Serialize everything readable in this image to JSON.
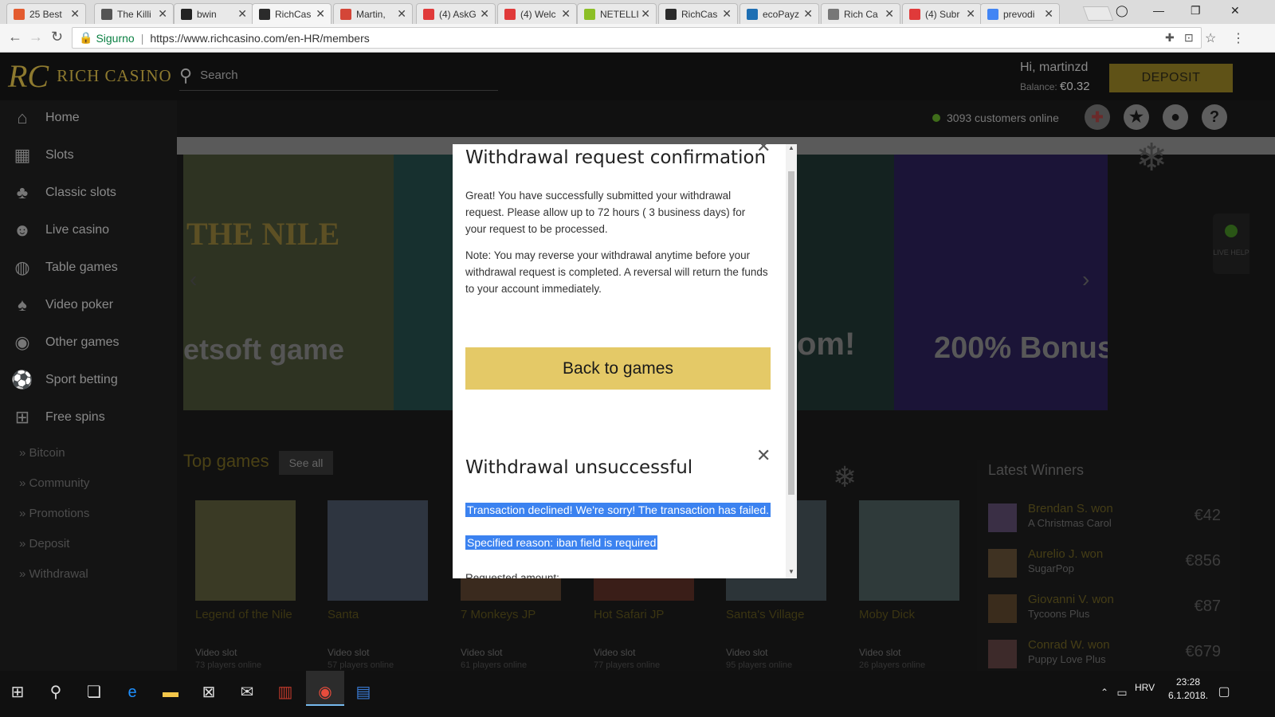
{
  "browser": {
    "tabs": [
      {
        "title": "25 Best",
        "color": "#e35b2f"
      },
      {
        "title": "The Killi",
        "color": "#555"
      },
      {
        "title": "bwin",
        "color": "#222"
      },
      {
        "title": "RichCas",
        "color": "#2b2b2b"
      },
      {
        "title": "Martin,",
        "color": "#d44638"
      },
      {
        "title": "(4) AskG",
        "color": "#e03a3a"
      },
      {
        "title": "(4) Welc",
        "color": "#e03a3a"
      },
      {
        "title": "NETELLI",
        "color": "#8cbf26"
      },
      {
        "title": "RichCas",
        "color": "#2b2b2b"
      },
      {
        "title": "ecoPayz",
        "color": "#1e6fb3"
      },
      {
        "title": "Rich Ca",
        "color": "#777"
      },
      {
        "title": "(4) Subr",
        "color": "#e03a3a"
      },
      {
        "title": "prevodi",
        "color": "#4285f4"
      }
    ],
    "secure_label": "Sigurno",
    "url": "https://www.richcasino.com/en-HR/members"
  },
  "site": {
    "brand": "RICH CASINO",
    "brand_mark": "RC",
    "search_placeholder": "Search",
    "greeting": "Hi, martinzd",
    "balance_label": "Balance:",
    "balance_value": "€0.32",
    "deposit_label": "DEPOSIT",
    "online_count": "3093 customers online",
    "live_help": "LIVE HELP"
  },
  "sidebar": {
    "items": [
      {
        "label": "Home",
        "icon": "⌂"
      },
      {
        "label": "Slots",
        "icon": "▦"
      },
      {
        "label": "Classic slots",
        "icon": "♣"
      },
      {
        "label": "Live casino",
        "icon": "☻"
      },
      {
        "label": "Table games",
        "icon": "◍"
      },
      {
        "label": "Video poker",
        "icon": "♠"
      },
      {
        "label": "Other games",
        "icon": "◉"
      },
      {
        "label": "Sport betting",
        "icon": "⚽"
      },
      {
        "label": "Free spins",
        "icon": "⊞"
      }
    ],
    "subitems": [
      "Bitcoin",
      "Community",
      "Promotions",
      "Deposit",
      "Withdrawal"
    ]
  },
  "banner": {
    "slide1_title": "THE NILE",
    "slide1_text": "etsoft game",
    "slide2_text": "om!",
    "slide3_text": "200% Bonus"
  },
  "games": {
    "heading": "Top games",
    "see_all": "See all",
    "items": [
      {
        "name": "Legend of the Nile",
        "type": "Video slot",
        "players": "73 players online"
      },
      {
        "name": "Santa",
        "type": "Video slot",
        "players": "57 players online"
      },
      {
        "name": "7 Monkeys JP",
        "type": "Video slot",
        "players": "61 players online"
      },
      {
        "name": "Hot Safari JP",
        "type": "Video slot",
        "players": "77 players online"
      },
      {
        "name": "Santa's Village",
        "type": "Video slot",
        "players": "95 players online"
      },
      {
        "name": "Moby Dick",
        "type": "Video slot",
        "players": "26 players online"
      }
    ]
  },
  "winners": {
    "title": "Latest Winners",
    "items": [
      {
        "name": "Brendan S. won",
        "game": "A Christmas Carol",
        "amount": "€42"
      },
      {
        "name": "Aurelio J. won",
        "game": "SugarPop",
        "amount": "€856"
      },
      {
        "name": "Giovanni V. won",
        "game": "Tycoons Plus",
        "amount": "€87"
      },
      {
        "name": "Conrad W. won",
        "game": "Puppy Love Plus",
        "amount": "€679"
      }
    ]
  },
  "modal": {
    "title1": "Withdrawal request confirmation",
    "para1": "Great! You have successfully submitted your withdrawal request. Please allow up to 72 hours ( 3 business days) for your request to be processed.",
    "para2": "Note: You may reverse your withdrawal anytime before your withdrawal request is completed. A reversal will return the funds to your account immediately.",
    "back_button": "Back to games",
    "title2": "Withdrawal unsuccessful",
    "error1": "Transaction declined! We're sorry! The transaction has failed.",
    "error2": "Specified reason: iban field is required",
    "amount_label": "Requested amount:"
  },
  "taskbar": {
    "time": "23:28",
    "date": "6.1.2018.",
    "lang": "HRV"
  }
}
